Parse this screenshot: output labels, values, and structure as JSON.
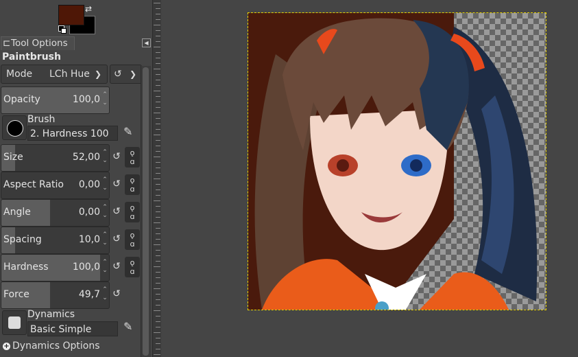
{
  "colors": {
    "foreground": "#4e1706",
    "background": "#000000",
    "hair_brown": "#6b4a3a",
    "hair_blue": "#1e2c44",
    "shirt_orange": "#ea5c1a",
    "skin": "#f3d6c8",
    "canvas_bg": "#454545",
    "selection_outline": "#e8d200"
  },
  "icons": {
    "swap": "swap-colors-icon",
    "reset": "default-colors-icon",
    "tab_menu": "tab-menu-icon",
    "tool_options": "tool-options-icon"
  },
  "tab": {
    "label": "Tool Options"
  },
  "tool": {
    "title": "Paintbrush"
  },
  "mode": {
    "label": "Mode",
    "value": "LCh Hue"
  },
  "opacity": {
    "label": "Opacity",
    "value": "100,0",
    "fraction": 1.0
  },
  "brush": {
    "label": "Brush",
    "name": "2. Hardness 100"
  },
  "sliders": [
    {
      "label": "Size",
      "value": "52,00",
      "fraction": 0.13,
      "chain": true
    },
    {
      "label": "Aspect Ratio",
      "value": "0,00",
      "fraction": 0.0,
      "chain": true
    },
    {
      "label": "Angle",
      "value": "0,00",
      "fraction": 0.45,
      "chain": true
    },
    {
      "label": "Spacing",
      "value": "10,0",
      "fraction": 0.13,
      "chain": true
    },
    {
      "label": "Hardness",
      "value": "100,0",
      "fraction": 0.92,
      "chain": true
    },
    {
      "label": "Force",
      "value": "49,7",
      "fraction": 0.45,
      "chain": false
    }
  ],
  "dynamics": {
    "label": "Dynamics",
    "name": "Basic Simple"
  },
  "dynamics_options": {
    "label": "Dynamics Options"
  }
}
